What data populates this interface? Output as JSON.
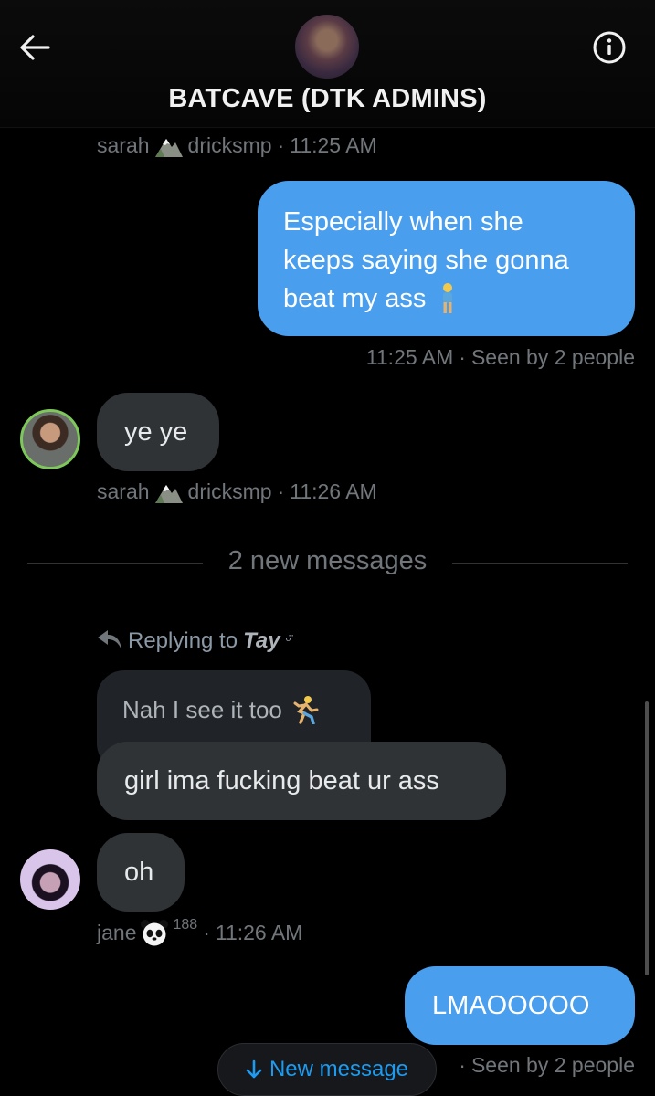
{
  "header": {
    "title": "BATCAVE (DTK ADMINS)",
    "back_icon": "arrow-left-icon",
    "info_icon": "info-icon"
  },
  "messages": {
    "m1_meta": {
      "sender": "sarah",
      "sender_suffix": "dricksmp",
      "time": "11:25 AM",
      "emoji": "mountain"
    },
    "m2": {
      "lines": [
        "Especially when she",
        "keeps saying she gonna",
        "beat my ass"
      ],
      "emoji": "person-standing"
    },
    "m2_meta": {
      "time": "11:25 AM",
      "seen": "Seen by 2 people"
    },
    "m3": {
      "text": "ye ye"
    },
    "m3_meta": {
      "sender": "sarah",
      "sender_suffix": "dricksmp",
      "time": "11:26 AM"
    },
    "divider": "2 new messages",
    "reply": {
      "prefix": "Replying to",
      "name": "Tay",
      "name_suffix": "ᵕ̈"
    },
    "m4_quoted": {
      "text": "Nah I see it too",
      "emoji": "person-running"
    },
    "m4": {
      "text": "girl ima fucking beat ur ass"
    },
    "m5": {
      "text": "oh"
    },
    "m5_meta": {
      "sender": "jane",
      "sender_suffix": "188",
      "time": "11:26 AM",
      "emoji": "panda"
    },
    "m6": {
      "text": "LMAOOOOO"
    },
    "m6_meta": {
      "seen": "Seen by 2 people"
    }
  },
  "new_message_pill": {
    "label": "New message",
    "icon": "arrow-down-icon"
  },
  "colors": {
    "accent": "#1d9bf0",
    "outgoing_bubble": "#4a9eee",
    "incoming_bubble": "#2f3336",
    "background": "#000000"
  }
}
